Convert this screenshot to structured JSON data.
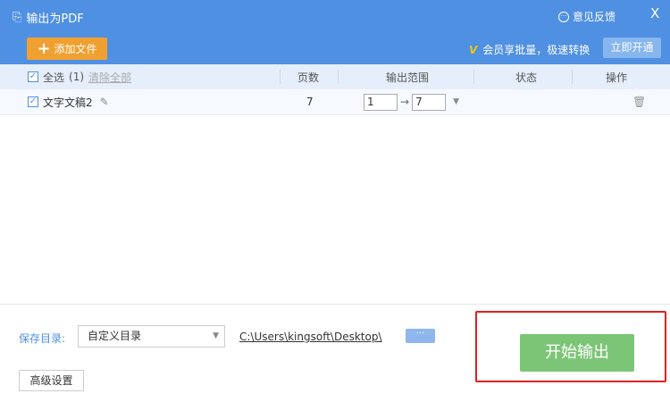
{
  "window": {
    "title": "输出为PDF",
    "feedback": "意见反馈",
    "close": "X"
  },
  "toolbar": {
    "add_files": "添加文件",
    "promo": "会员享批量，极速转换",
    "activate": "立即开通"
  },
  "table": {
    "select_all": "全选",
    "count": "(1)",
    "clear_all": "清除全部",
    "headers": {
      "pages": "页数",
      "range": "输出范围",
      "status": "状态",
      "actions": "操作"
    },
    "rows": [
      {
        "name": "文字文稿2",
        "pages": "7",
        "from": "1",
        "to": "7",
        "checked": true
      }
    ]
  },
  "footer": {
    "save_dir_label": "保存目录:",
    "dir_option": "自定义目录",
    "path": "C:\\Users\\kingsoft\\Desktop\\",
    "browse": "···",
    "advanced": "高级设置",
    "start": "开始输出"
  },
  "colors": {
    "header": "#4f90e2",
    "add": "#f0a030",
    "start": "#7cc576",
    "highlight": "#e02020"
  }
}
